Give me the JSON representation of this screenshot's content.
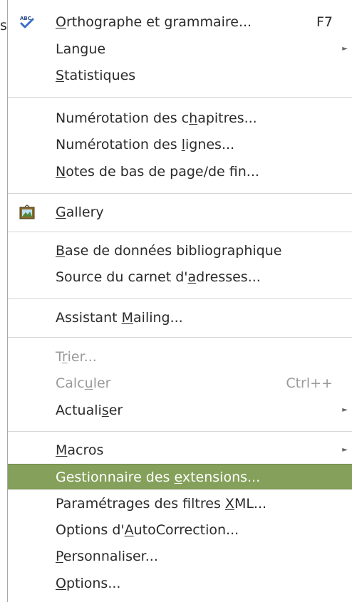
{
  "edge_text": "s",
  "menu": {
    "items": [
      {
        "pre": "",
        "ul": "O",
        "post": "rthographe et grammaire...",
        "accel": "F7",
        "icon": "spellcheck-icon"
      },
      {
        "pre": "Langue",
        "ul": "",
        "post": "",
        "submenu": true
      },
      {
        "pre": "",
        "ul": "S",
        "post": "tatistiques"
      },
      {
        "pre": "Numérotation des c",
        "ul": "h",
        "post": "apitres..."
      },
      {
        "pre": "Numérotation des ",
        "ul": "l",
        "post": "ignes..."
      },
      {
        "pre": "",
        "ul": "N",
        "post": "otes de bas de page/de fin..."
      },
      {
        "pre": "",
        "ul": "G",
        "post": "allery",
        "icon": "gallery-icon"
      },
      {
        "pre": "",
        "ul": "B",
        "post": "ase de données bibliographique"
      },
      {
        "pre": "Source du carnet d'",
        "ul": "a",
        "post": "dresses..."
      },
      {
        "pre": "Assistant ",
        "ul": "M",
        "post": "ailing..."
      },
      {
        "pre": "T",
        "ul": "r",
        "post": "ier...",
        "disabled": true
      },
      {
        "pre": "Calc",
        "ul": "u",
        "post": "ler",
        "accel": "Ctrl++",
        "disabled": true
      },
      {
        "pre": "Actuali",
        "ul": "s",
        "post": "er",
        "submenu": true
      },
      {
        "pre": "",
        "ul": "M",
        "post": "acros",
        "submenu": true
      },
      {
        "pre": "Gestionnaire des ",
        "ul": "e",
        "post": "xtensions...",
        "highlighted": true
      },
      {
        "pre": "Paramétrages des filtres ",
        "ul": "X",
        "post": "ML..."
      },
      {
        "pre": "Options d'",
        "ul": "A",
        "post": "utoCorrection..."
      },
      {
        "pre": "",
        "ul": "P",
        "post": "ersonnaliser..."
      },
      {
        "pre": "",
        "ul": "O",
        "post": "ptions..."
      }
    ],
    "submenu_arrow": "►"
  },
  "colors": {
    "highlight": "#84a05a",
    "text": "#2b2b2b",
    "disabled": "#9a9a9a"
  }
}
